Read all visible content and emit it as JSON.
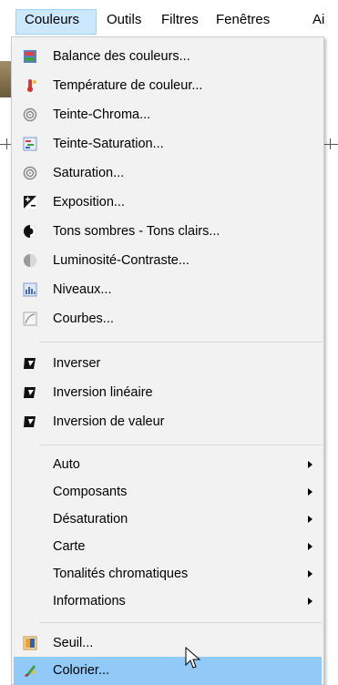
{
  "menubar": {
    "items": [
      {
        "label": "Couleurs"
      },
      {
        "label": "Outils"
      },
      {
        "label": "Filtres"
      },
      {
        "label": "Fenêtres"
      },
      {
        "label": "Ai"
      }
    ]
  },
  "menu": {
    "group1": [
      {
        "label": "Balance des couleurs...",
        "icon": "color-balance-icon"
      },
      {
        "label": "Température de couleur...",
        "icon": "thermometer-icon"
      },
      {
        "label": "Teinte-Chroma...",
        "icon": "spiral-icon"
      },
      {
        "label": "Teinte-Saturation...",
        "icon": "hue-saturation-icon"
      },
      {
        "label": "Saturation...",
        "icon": "spiral-icon"
      },
      {
        "label": "Exposition...",
        "icon": "exposure-icon"
      },
      {
        "label": "Tons sombres - Tons clairs...",
        "icon": "shadows-highlights-icon"
      },
      {
        "label": "Luminosité-Contraste...",
        "icon": "brightness-contrast-icon"
      },
      {
        "label": "Niveaux...",
        "icon": "levels-icon"
      },
      {
        "label": "Courbes...",
        "icon": "curves-icon"
      }
    ],
    "group2": [
      {
        "label": "Inverser",
        "icon": "invert-icon"
      },
      {
        "label": "Inversion linéaire",
        "icon": "invert-icon"
      },
      {
        "label": "Inversion de valeur",
        "icon": "invert-icon"
      }
    ],
    "group3": [
      {
        "label": "Auto"
      },
      {
        "label": "Composants"
      },
      {
        "label": "Désaturation"
      },
      {
        "label": "Carte"
      },
      {
        "label": "Tonalités chromatiques"
      },
      {
        "label": "Informations"
      }
    ],
    "group4": [
      {
        "label": "Seuil...",
        "icon": "threshold-icon"
      },
      {
        "label": "Colorier...",
        "icon": "colorize-icon"
      }
    ]
  },
  "colors": {
    "highlight": "#91c9f7",
    "menubar_active": "#cce8ff",
    "menu_bg": "#f2f2f2"
  }
}
